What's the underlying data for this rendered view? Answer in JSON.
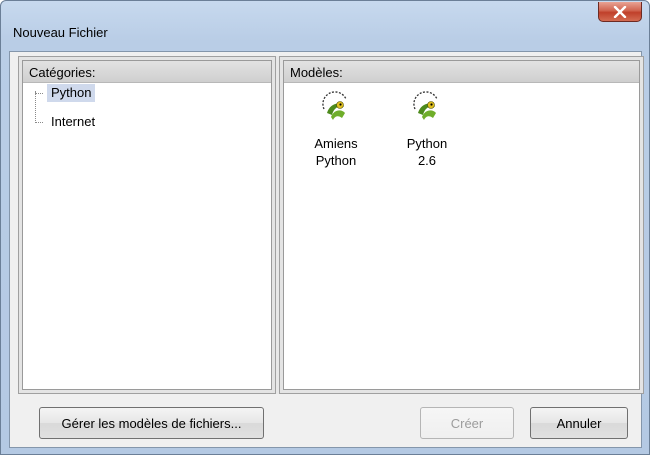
{
  "window": {
    "title": "Nouveau Fichier",
    "close_glyph": "×"
  },
  "categories": {
    "header": "Catégories:",
    "items": [
      {
        "label": "Python",
        "selected": true
      },
      {
        "label": "Internet",
        "selected": false
      }
    ]
  },
  "models": {
    "header": "Modèles:",
    "items": [
      {
        "label": "Amiens Python",
        "icon": "python-snake-icon"
      },
      {
        "label": "Python 2.6",
        "icon": "python-snake-icon"
      }
    ]
  },
  "buttons": {
    "manage_label": "Gérer les modèles de fichiers...",
    "create_label": "Créer",
    "create_enabled": false,
    "cancel_label": "Annuler"
  },
  "colors": {
    "selection": "#cfd9ec",
    "close_button": "#c0402a",
    "title_bar": "#b9cde6"
  }
}
